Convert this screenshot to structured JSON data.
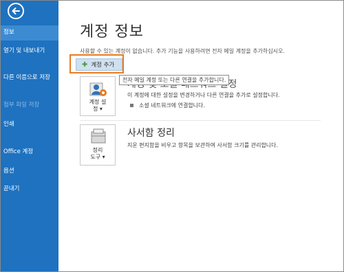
{
  "sidebar": {
    "back_label": "",
    "items": [
      {
        "label": "정보"
      },
      {
        "label": "열기 및 내보내기"
      },
      {
        "label": "다른 이름으로 저장"
      },
      {
        "label": "첨부 파일 저장"
      },
      {
        "label": "인쇄"
      },
      {
        "label": "Office 계정"
      },
      {
        "label": "옵션"
      },
      {
        "label": "끝내기"
      }
    ]
  },
  "main": {
    "title": "계정 정보",
    "notice": "사용할 수 있는 계정이 없습니다. 추가 기능을 사용하려면 전자 메일 계정을 추가하십시오.",
    "add_account_label": "계정 추가",
    "tooltip": "전자 메일 계정 또는 다른 연결을 추가합니다.",
    "account_settings": {
      "title_visible": "계정 및 소셜 네트워크 설정",
      "description": "이 계정에 대한 설정을 변경하거나 다른 연결을 추가로 설정합니다.",
      "bullet": "소셜 네트워크에 연결합니다.",
      "tile_label_line1": "계정 설",
      "tile_label_line2": "정 ▾"
    },
    "mailbox_cleanup": {
      "title": "사서함 정리",
      "description": "지운 편지함을 비우고 항목을 보관하여 사서함 크기를 관리합니다.",
      "tile_label_line1": "정리",
      "tile_label_line2": "도구 ▾"
    }
  },
  "colors": {
    "sidebar_bg": "#1e72c0",
    "sidebar_active": "#3c8bd2",
    "highlight": "#e87b1e",
    "button_bg": "#cfe0f0"
  }
}
